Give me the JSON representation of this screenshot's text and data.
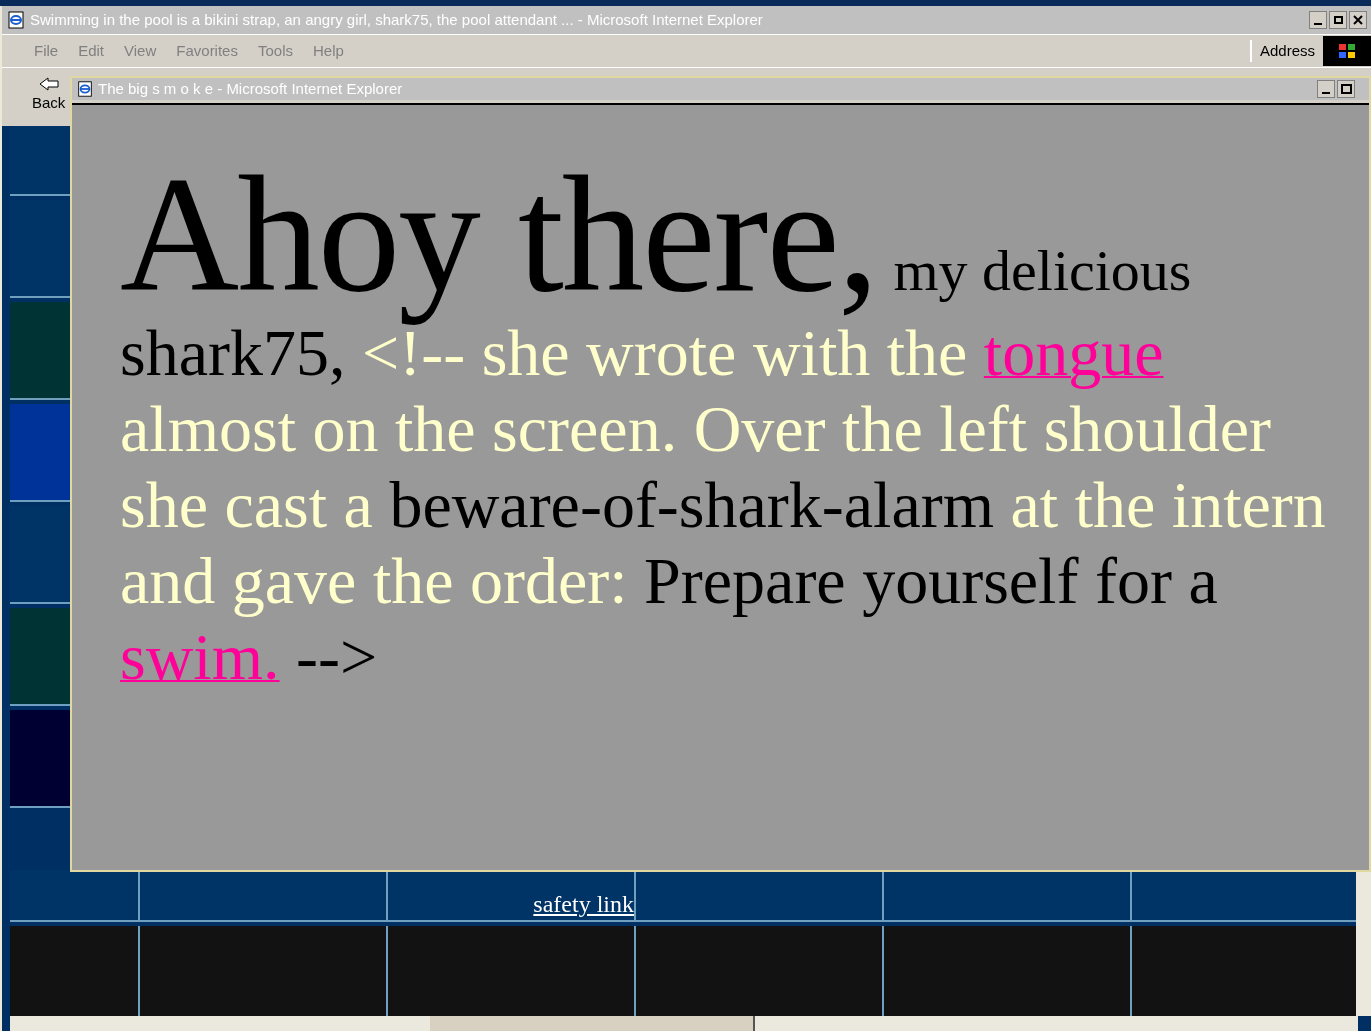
{
  "main_window": {
    "title": "Swimming in the pool is a bikini strap, an angry girl, shark75, the pool attendant ... - Microsoft Internet Explorer",
    "menu": [
      "File",
      "Edit",
      "View",
      "Favorites",
      "Tools",
      "Help"
    ],
    "address_label": "Address",
    "back_button": "Back",
    "page_link": "safety link"
  },
  "popup": {
    "title": "The big s m o k e - Microsoft Internet Explorer",
    "segments": [
      {
        "text": "Ahoy there,",
        "kind": "heading"
      },
      {
        "text": "my delicious",
        "kind": "lead"
      },
      {
        "text": "shark75,",
        "kind": "plain"
      },
      {
        "text": "<!-- she wrote with the",
        "kind": "comment"
      },
      {
        "text": "tongue",
        "kind": "link"
      },
      {
        "text": "almost on the screen. Over the left shoulder she cast a",
        "kind": "comment"
      },
      {
        "text": "beware-of-shark-alarm",
        "kind": "plain"
      },
      {
        "text": "at the intern and gave the order:",
        "kind": "comment"
      },
      {
        "text": "Prepare yourself for a",
        "kind": "plain"
      },
      {
        "text": "swim.",
        "kind": "link"
      },
      {
        "text": "-->",
        "kind": "plain"
      }
    ]
  }
}
